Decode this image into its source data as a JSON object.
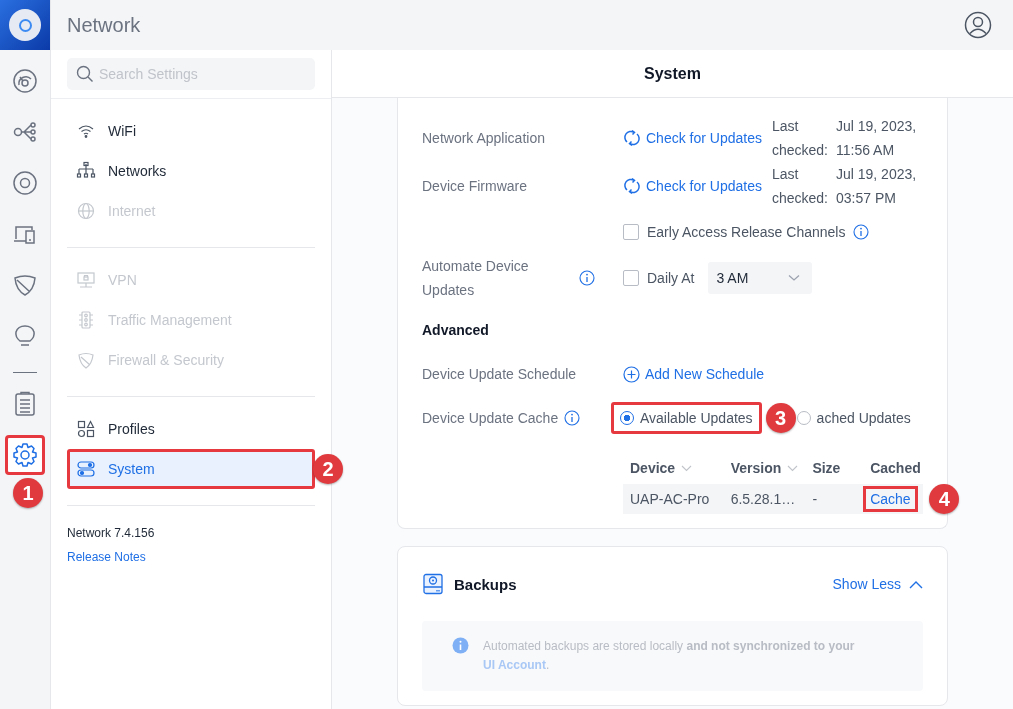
{
  "app": {
    "title": "Network"
  },
  "rail": [
    {
      "kind": "dashboard",
      "selected": false,
      "highlighted": false
    },
    {
      "kind": "topology",
      "selected": false,
      "highlighted": false
    },
    {
      "kind": "devices",
      "selected": false,
      "highlighted": false
    },
    {
      "kind": "clients",
      "selected": false,
      "highlighted": false
    },
    {
      "kind": "shield",
      "selected": false,
      "highlighted": false
    },
    {
      "kind": "insights",
      "selected": false,
      "highlighted": false
    },
    {
      "kind": "logs",
      "selected": false,
      "highlighted": false,
      "divider_before": true
    },
    {
      "kind": "settings",
      "selected": true,
      "highlighted": true,
      "badge": "1"
    }
  ],
  "search": {
    "placeholder": "Search Settings"
  },
  "page_title": "System",
  "sidebar": {
    "groups": [
      [
        {
          "label": "WiFi",
          "kind": "wifi",
          "disabled": false,
          "selected": false,
          "highlighted": false
        },
        {
          "label": "Networks",
          "kind": "networks",
          "disabled": false,
          "selected": false,
          "highlighted": false
        },
        {
          "label": "Internet",
          "kind": "globe",
          "disabled": true,
          "selected": false,
          "highlighted": false
        }
      ],
      [
        {
          "label": "VPN",
          "kind": "vpn",
          "disabled": true,
          "selected": false,
          "highlighted": false
        },
        {
          "label": "Traffic Management",
          "kind": "traffic",
          "disabled": true,
          "selected": false,
          "highlighted": false
        },
        {
          "label": "Firewall & Security",
          "kind": "shield",
          "disabled": true,
          "selected": false,
          "highlighted": false
        }
      ],
      [
        {
          "label": "Profiles",
          "kind": "profiles",
          "disabled": false,
          "selected": false,
          "highlighted": false
        },
        {
          "label": "System",
          "kind": "system",
          "disabled": false,
          "selected": true,
          "highlighted": true,
          "badge": "2"
        }
      ]
    ],
    "version": "Network 7.4.156",
    "release_notes": "Release Notes"
  },
  "updates": {
    "checks": [
      {
        "label": "Network Application",
        "action": "Check for Updates",
        "last_label": "Last checked:",
        "last_value": "Jul 19, 2023, 11:56 AM"
      },
      {
        "label": "Device Firmware",
        "action": "Check for Updates",
        "last_label": "Last checked:",
        "last_value": "Jul 19, 2023, 03:57 PM"
      }
    ],
    "early_access": {
      "label": "Early Access Release Channels",
      "checked": false
    },
    "automate": {
      "label": "Automate Device Updates",
      "checkbox": "Daily At",
      "checked": false,
      "time": "3 AM"
    },
    "advanced_title": "Advanced",
    "schedule": {
      "label": "Device Update Schedule",
      "action": "Add New Schedule"
    },
    "cache": {
      "label": "Device Update Cache",
      "options": [
        {
          "label": "Available Updates",
          "selected": true,
          "highlighted": true,
          "badge": "3"
        },
        {
          "label": "ached Updates",
          "selected": false,
          "highlighted": false
        }
      ]
    },
    "table": {
      "columns": [
        {
          "label": "Device",
          "sortable": true
        },
        {
          "label": "Version",
          "sortable": true
        },
        {
          "label": "Size",
          "sortable": false
        },
        {
          "label": "Cached",
          "sortable": false
        }
      ],
      "rows": [
        {
          "cells": [
            "UAP-AC-Pro",
            "6.5.28.1…",
            "-"
          ],
          "action": "Cache",
          "highlighted": true,
          "badge": "4"
        }
      ]
    }
  },
  "backups": {
    "title": "Backups",
    "toggle": "Show Less",
    "expanded": true,
    "notice": {
      "text": "Automated backups are stored locally **and not synchronized to your**",
      "link": "UI Account",
      "tail": "."
    }
  }
}
